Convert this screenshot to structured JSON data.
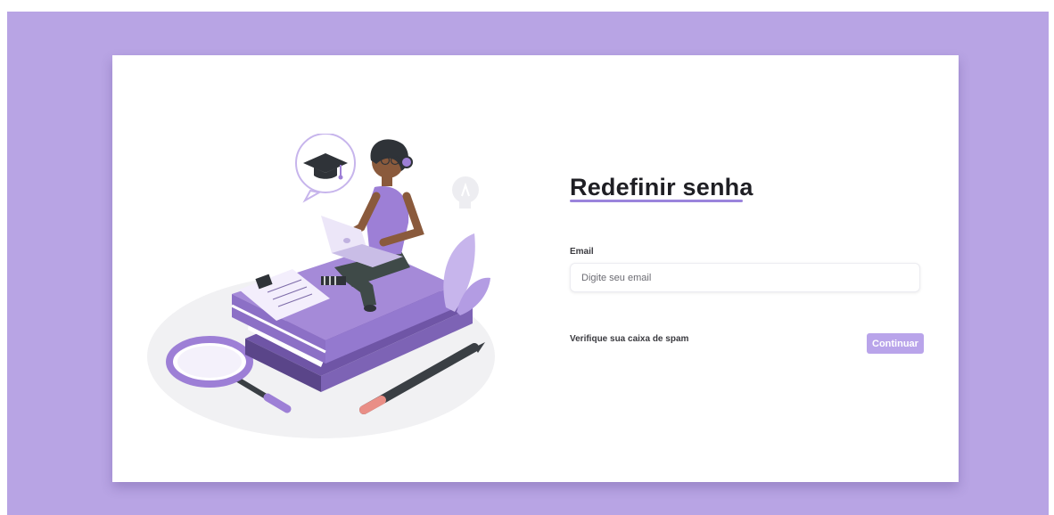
{
  "reset": {
    "title": "Redefinir senha",
    "email_label": "Email",
    "email_placeholder": "Digite seu email",
    "email_value": "",
    "spam_hint": "Verifique sua caixa de spam",
    "continue_label": "Continuar"
  },
  "colors": {
    "page_background": "#b8a4e4",
    "card_background": "#ffffff",
    "accent": "#9b84dc",
    "button": "#b9a4ea"
  },
  "illustration": {
    "icons": [
      "graduation-cap-icon",
      "lightbulb-icon",
      "laptop-icon",
      "magnifying-glass-icon",
      "pencil-icon",
      "books-icon",
      "note-icon"
    ]
  }
}
